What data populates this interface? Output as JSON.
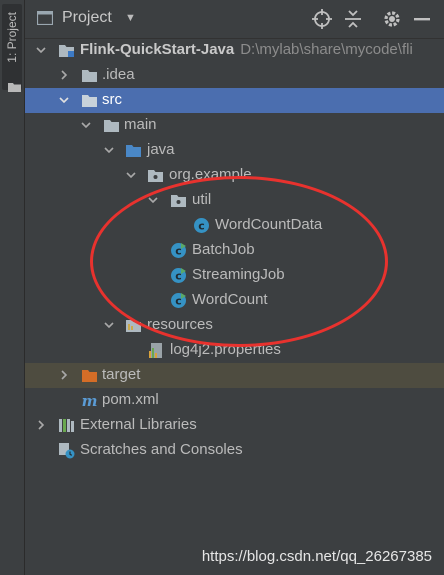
{
  "stripe": {
    "tab_label": "1: Project"
  },
  "header": {
    "title": "Project"
  },
  "tree": {
    "root": {
      "name": "Flink-QuickStart-Java",
      "path": "D:\\mylab\\share\\mycode\\fli"
    },
    "idea": "idea",
    "src": "src",
    "main": "main",
    "java": "java",
    "package": "org.example",
    "util": "util",
    "word_count_data": "WordCountData",
    "batch_job": "BatchJob",
    "streaming_job": "StreamingJob",
    "word_count": "WordCount",
    "resources": "resources",
    "log4j2": "log4j2.properties",
    "target": "target",
    "pom": "pom.xml",
    "external_libraries": "External Libraries",
    "scratches": "Scratches and Consoles"
  },
  "watermark": "https://blog.csdn.net/qq_26267385",
  "colors": {
    "panel_bg": "#3c3f41",
    "selection": "#4b6eaf",
    "excluded_row": "#4e4c40",
    "annotation_oval": "#e8322e"
  }
}
